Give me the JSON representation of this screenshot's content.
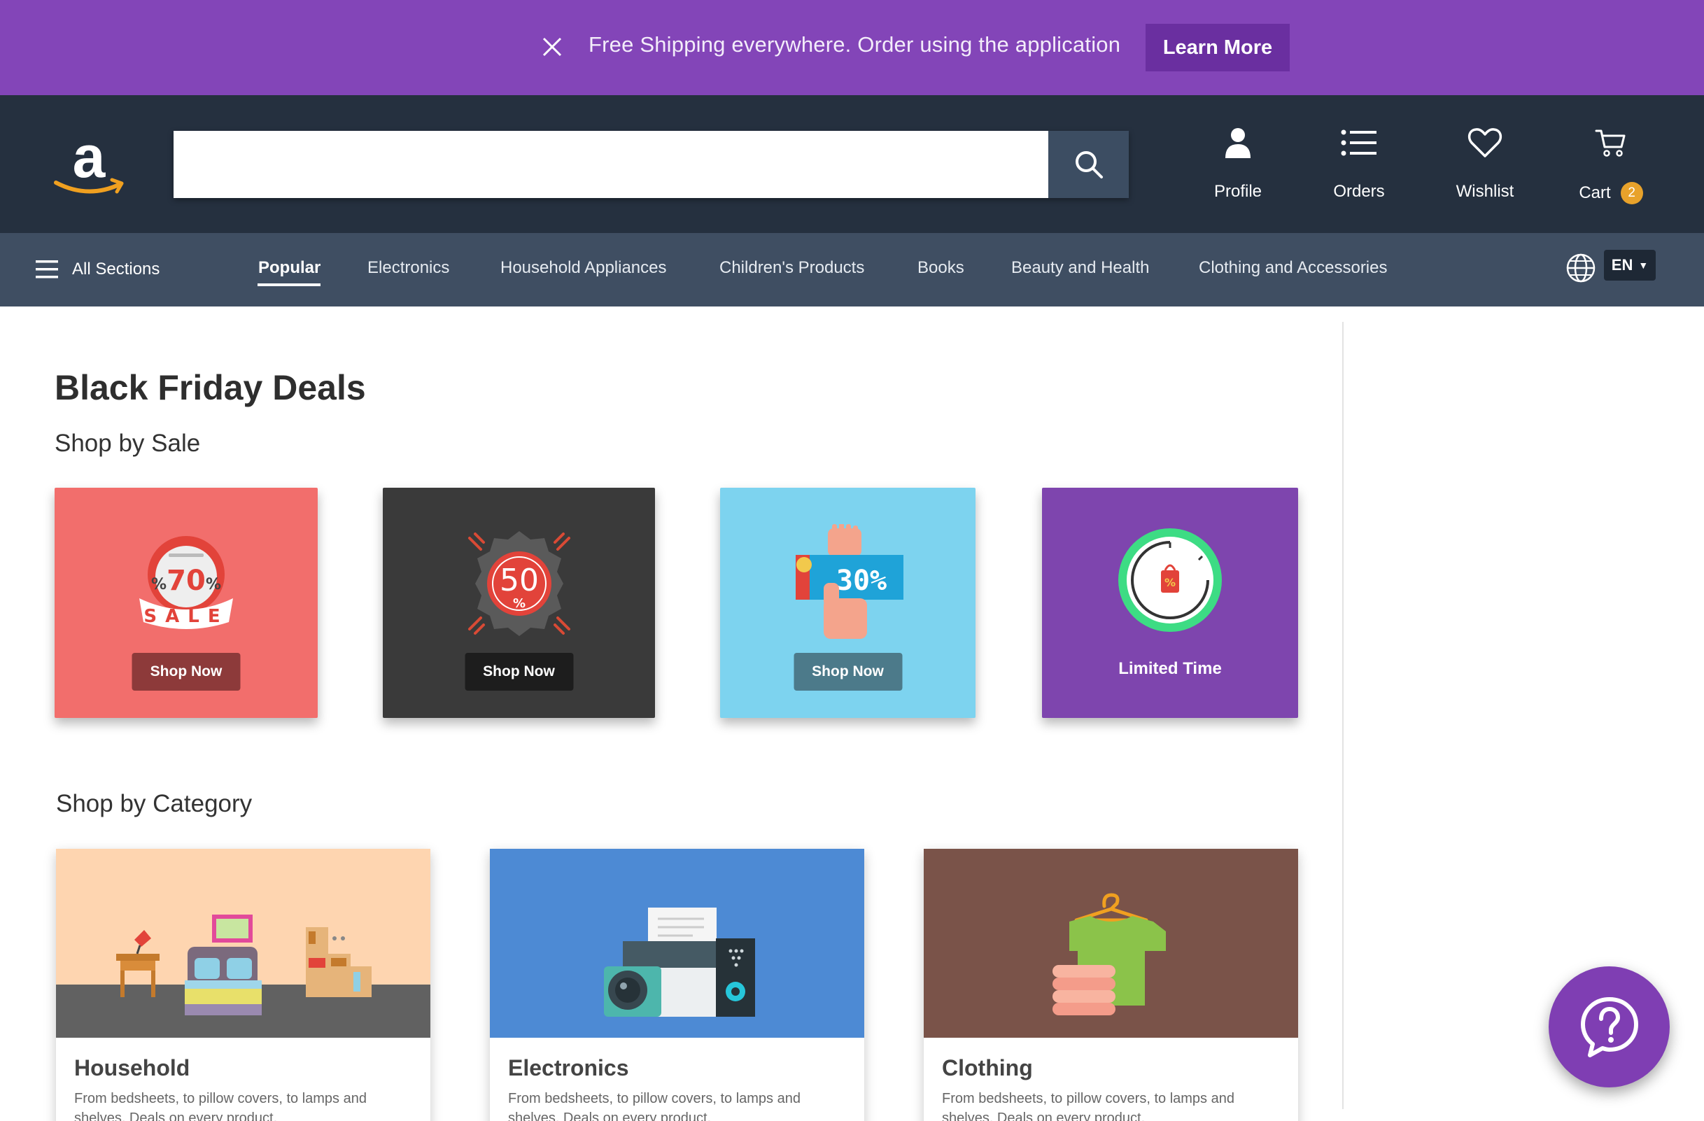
{
  "promo": {
    "message": "Free Shipping everywhere. Order using the application",
    "cta_label": "Learn More"
  },
  "header": {
    "search": {
      "value": "",
      "placeholder": ""
    },
    "nav": {
      "profile_label": "Profile",
      "orders_label": "Orders",
      "wishlist_label": "Wishlist",
      "cart_label": "Cart",
      "cart_count": "2"
    }
  },
  "categories": {
    "all_sections_label": "All Sections",
    "items": [
      {
        "label": "Popular",
        "active": true
      },
      {
        "label": "Electronics"
      },
      {
        "label": "Household Appliances"
      },
      {
        "label": "Children's Products"
      },
      {
        "label": "Books"
      },
      {
        "label": "Beauty and Health"
      },
      {
        "label": "Clothing and Accessories"
      }
    ],
    "language": "EN"
  },
  "main": {
    "title": "Black Friday Deals",
    "sale_section_title": "Shop by Sale",
    "sale_cards": [
      {
        "badge_text": "70",
        "badge_sub": "SALE",
        "button_label": "Shop Now",
        "color": "#f26e6c",
        "button_color": "#8d3a3a"
      },
      {
        "badge_text": "50",
        "badge_sub": "%",
        "button_label": "Shop Now",
        "color": "#3a3a3a",
        "button_color": "#1d1d1d"
      },
      {
        "badge_text": "30%",
        "button_label": "Shop Now",
        "color": "#7dd3ef",
        "button_color": "#4c7a8a"
      },
      {
        "label": "Limited Time",
        "color": "#7e45ae"
      }
    ],
    "category_section_title": "Shop by Category",
    "category_cards": [
      {
        "title": "Household",
        "description": "From bedsheets, to pillow covers, to lamps and shelves. Deals on every product.",
        "color": "#fed5b0"
      },
      {
        "title": "Electronics",
        "description": "From bedsheets, to pillow covers, to lamps and shelves. Deals on every product.",
        "color": "#4d8ad4"
      },
      {
        "title": "Clothing",
        "description": "From bedsheets, to pillow covers, to lamps and shelves. Deals on every product.",
        "color": "#7a5349"
      }
    ]
  },
  "colors": {
    "promo_bg": "#8345b8",
    "header_bg": "#25303f",
    "catnav_bg": "#3f4e62",
    "cart_badge": "#e8a22b",
    "help_fab": "#7f3eb3"
  }
}
